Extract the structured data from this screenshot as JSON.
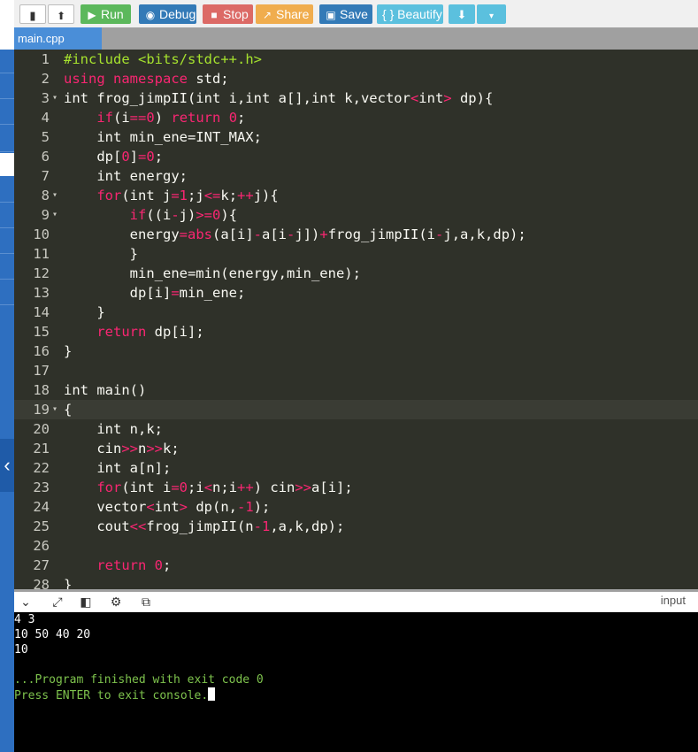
{
  "toolbar": {
    "run": "Run",
    "debug": "Debug",
    "stop": "Stop",
    "share": "Share",
    "save": "Save",
    "beautify": "{ } Beautify"
  },
  "colors": {
    "run": "#5cb85c",
    "debug": "#337ab7",
    "stop": "#d9534f",
    "share": "#f0ad4e",
    "save": "#337ab7",
    "beautify": "#5bc0de",
    "download": "#5bc0de"
  },
  "tabs": {
    "active": "main.cpp"
  },
  "editor": {
    "active_line": 19,
    "lines": [
      {
        "n": "1",
        "fold": "",
        "html": "<span class='pp'>#include</span> <span class='pp'>&lt;bits/stdc++.h&gt;</span>"
      },
      {
        "n": "2",
        "fold": "",
        "html": "<span class='k'>using namespace</span> std;"
      },
      {
        "n": "3",
        "fold": "▾",
        "html": "int frog_jimpII(int i,int a[],int k,vector<span class='k'>&lt;</span>int<span class='k'>&gt;</span> dp){"
      },
      {
        "n": "4",
        "fold": "",
        "html": "    <span class='k'>if</span>(i<span class='k'>==</span><span class='k'>0</span>) <span class='k'>return</span> <span class='k'>0</span>;"
      },
      {
        "n": "5",
        "fold": "",
        "html": "    int min_ene=INT_MAX;"
      },
      {
        "n": "6",
        "fold": "",
        "html": "    dp[<span class='k'>0</span>]<span class='k'>=</span><span class='k'>0</span>;"
      },
      {
        "n": "7",
        "fold": "",
        "html": "    int energy;"
      },
      {
        "n": "8",
        "fold": "▾",
        "html": "    <span class='k'>for</span>(int j<span class='k'>=</span><span class='k'>1</span>;j<span class='k'>&lt;=</span>k;<span class='k'>++</span>j){"
      },
      {
        "n": "9",
        "fold": "▾",
        "html": "        <span class='k'>if</span>((i<span class='k'>-</span>j)<span class='k'>&gt;=</span><span class='k'>0</span>){"
      },
      {
        "n": "10",
        "fold": "",
        "html": "        energy<span class='k'>=</span><span class='k'>abs</span>(a[i]<span class='k'>-</span>a[i<span class='k'>-</span>j])<span class='k'>+</span>frog_jimpII(i<span class='k'>-</span>j,a,k,dp);"
      },
      {
        "n": "11",
        "fold": "",
        "html": "        }"
      },
      {
        "n": "12",
        "fold": "",
        "html": "        min_ene=min(energy,min_ene);"
      },
      {
        "n": "13",
        "fold": "",
        "html": "        dp[i]<span class='k'>=</span>min_ene;"
      },
      {
        "n": "14",
        "fold": "",
        "html": "    }"
      },
      {
        "n": "15",
        "fold": "",
        "html": "    <span class='k'>return</span> dp[i];"
      },
      {
        "n": "16",
        "fold": "",
        "html": "}"
      },
      {
        "n": "17",
        "fold": "",
        "html": ""
      },
      {
        "n": "18",
        "fold": "",
        "html": "int main()"
      },
      {
        "n": "19",
        "fold": "▾",
        "html": "{"
      },
      {
        "n": "20",
        "fold": "",
        "html": "    int n,k;"
      },
      {
        "n": "21",
        "fold": "",
        "html": "    cin<span class='k'>&gt;&gt;</span>n<span class='k'>&gt;&gt;</span>k;"
      },
      {
        "n": "22",
        "fold": "",
        "html": "    int a[n];"
      },
      {
        "n": "23",
        "fold": "",
        "html": "    <span class='k'>for</span>(int i<span class='k'>=</span><span class='k'>0</span>;i<span class='k'>&lt;</span>n;i<span class='k'>++</span>) cin<span class='k'>&gt;&gt;</span>a[i];"
      },
      {
        "n": "24",
        "fold": "",
        "html": "    vector<span class='k'>&lt;</span>int<span class='k'>&gt;</span> dp(n,<span class='k'>-1</span>);"
      },
      {
        "n": "25",
        "fold": "",
        "html": "    cout<span class='k'>&lt;&lt;</span>frog_jimpII(n<span class='k'>-1</span>,a,k,dp);"
      },
      {
        "n": "26",
        "fold": "",
        "html": ""
      },
      {
        "n": "27",
        "fold": "",
        "html": "    <span class='k'>return</span> <span class='k'>0</span>;"
      },
      {
        "n": "28",
        "fold": "",
        "html": "}"
      }
    ]
  },
  "bottom_bar": {
    "input_label": "input"
  },
  "console": {
    "lines": [
      "4 3",
      "10 50 40 20",
      "10",
      ""
    ],
    "finished": "...Program finished with exit code 0",
    "press_enter": "Press ENTER to exit console."
  }
}
